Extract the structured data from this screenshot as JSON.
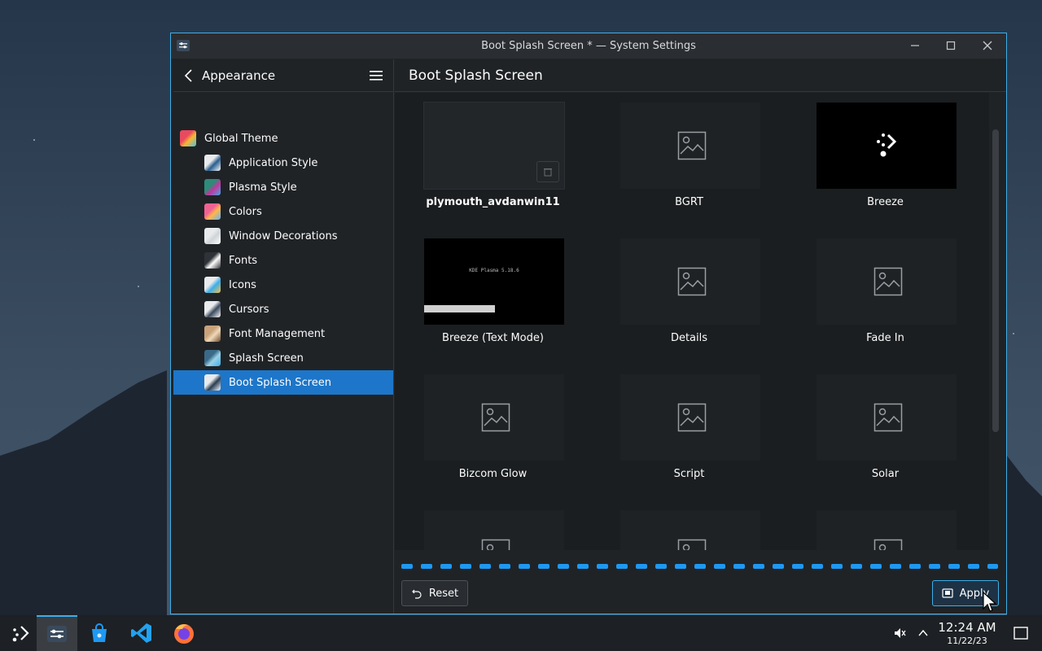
{
  "window": {
    "title": "Boot Splash Screen * — System Settings",
    "accent": "#3daee9"
  },
  "sidebar": {
    "back_label": "Appearance",
    "items": [
      {
        "label": "Global Theme",
        "icon": "global-theme-icon",
        "indent": false
      },
      {
        "label": "Application Style",
        "icon": "application-style-icon",
        "indent": true
      },
      {
        "label": "Plasma Style",
        "icon": "plasma-style-icon",
        "indent": true
      },
      {
        "label": "Colors",
        "icon": "colors-icon",
        "indent": true
      },
      {
        "label": "Window Decorations",
        "icon": "window-decorations-icon",
        "indent": true
      },
      {
        "label": "Fonts",
        "icon": "fonts-icon",
        "indent": true
      },
      {
        "label": "Icons",
        "icon": "icons-icon",
        "indent": true
      },
      {
        "label": "Cursors",
        "icon": "cursors-icon",
        "indent": true
      },
      {
        "label": "Font Management",
        "icon": "font-management-icon",
        "indent": true
      },
      {
        "label": "Splash Screen",
        "icon": "splash-screen-icon",
        "indent": true
      },
      {
        "label": "Boot Splash Screen",
        "icon": "boot-splash-screen-icon",
        "indent": true,
        "selected": true
      }
    ]
  },
  "main": {
    "header": "Boot Splash Screen",
    "themes": [
      {
        "label": "plymouth_avdanwin11",
        "preview": "custom",
        "bold": true,
        "selected": true
      },
      {
        "label": "BGRT",
        "preview": "placeholder"
      },
      {
        "label": "Breeze",
        "preview": "breeze"
      },
      {
        "label": "Breeze (Text Mode)",
        "preview": "text-mode",
        "preview_text": "KDE Plasma 5.18.6"
      },
      {
        "label": "Details",
        "preview": "placeholder"
      },
      {
        "label": "Fade In",
        "preview": "placeholder"
      },
      {
        "label": "Bizcom Glow",
        "preview": "placeholder"
      },
      {
        "label": "Script",
        "preview": "placeholder"
      },
      {
        "label": "Solar",
        "preview": "placeholder"
      }
    ],
    "reset_label": "Reset",
    "apply_label": "Apply",
    "busy": true
  },
  "taskbar": {
    "items": [
      "application-launcher-icon",
      "system-settings-icon",
      "discover-store-icon",
      "vscode-icon",
      "firefox-icon"
    ],
    "active": "system-settings-icon",
    "time": "12:24 AM",
    "date": "11/22/23"
  }
}
